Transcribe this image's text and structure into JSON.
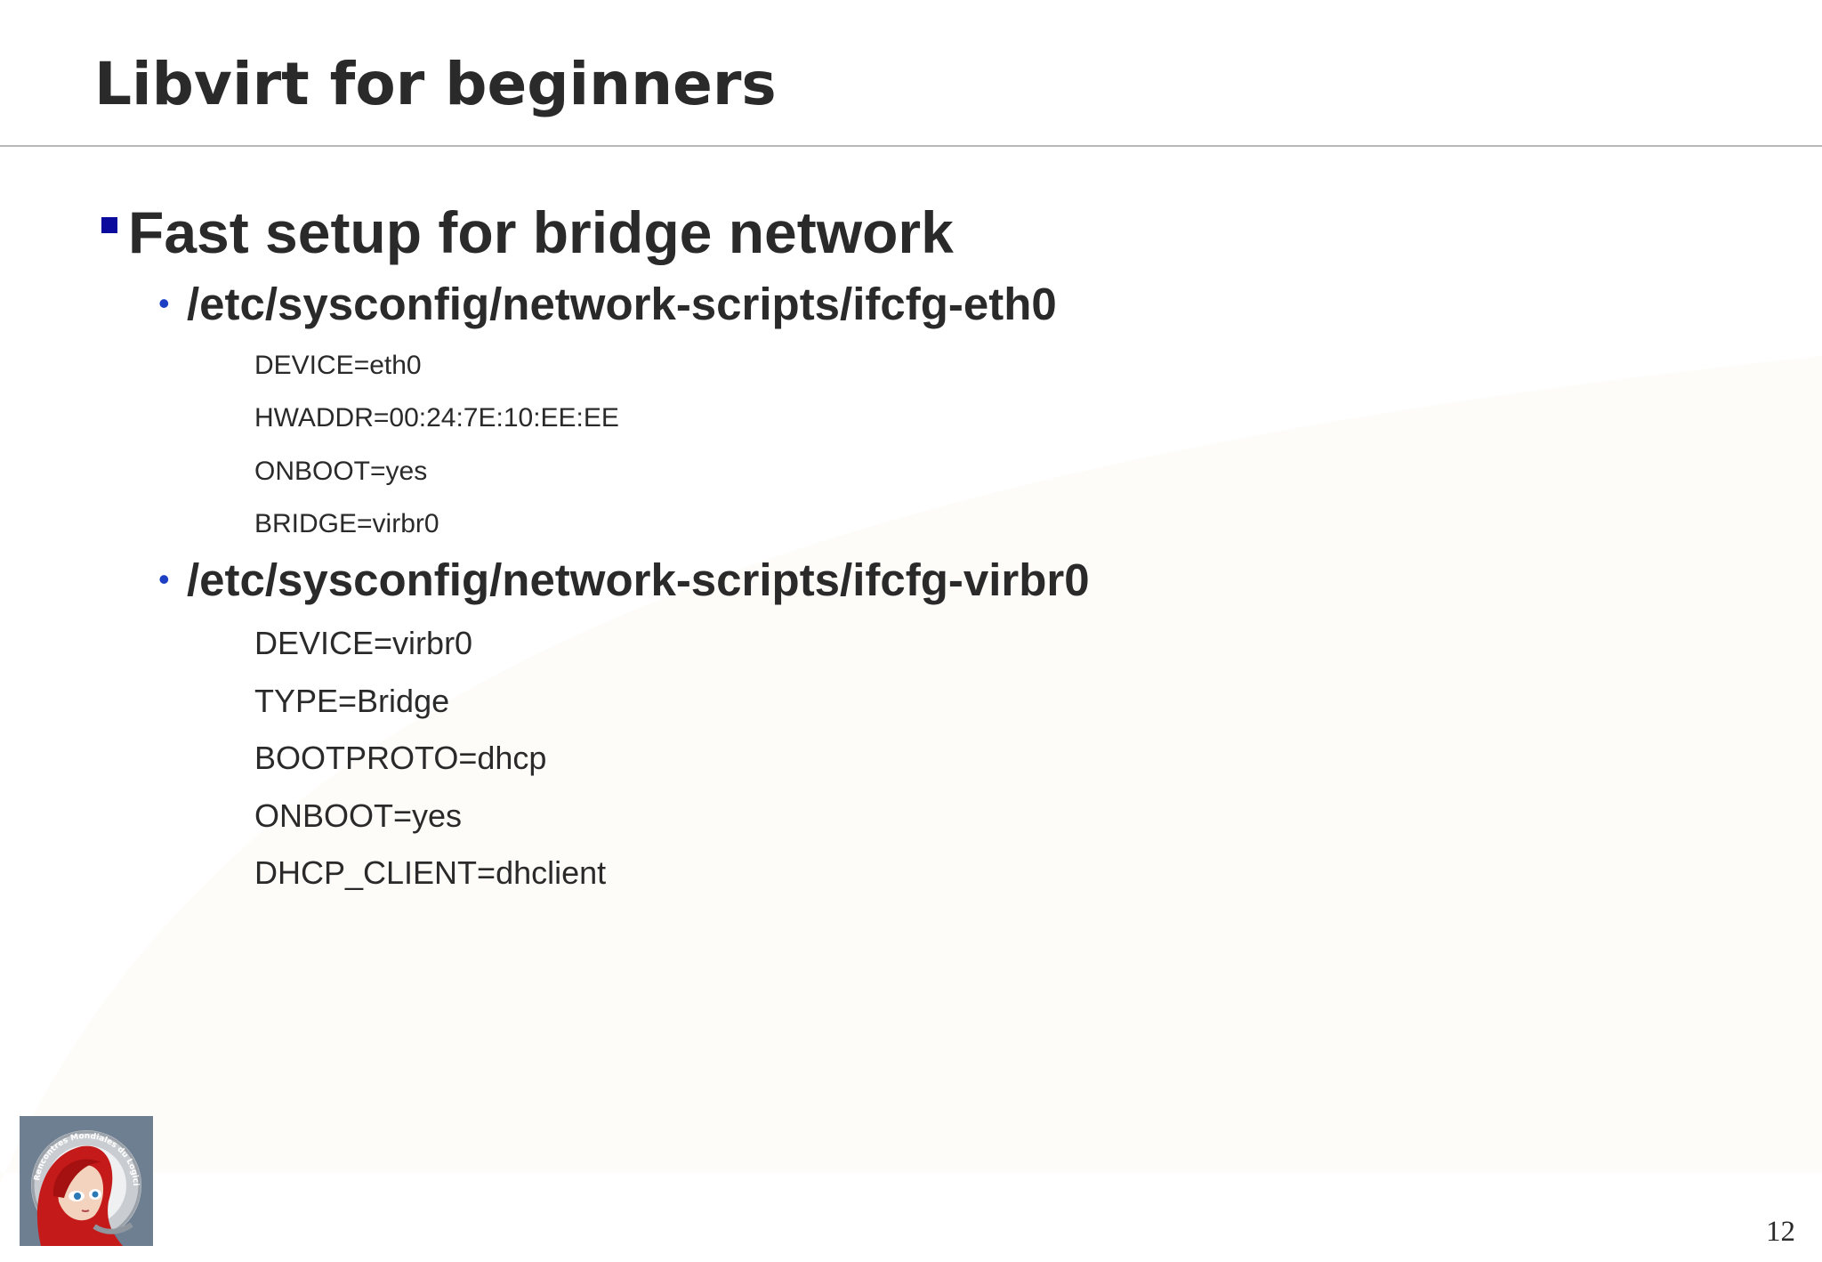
{
  "slide": {
    "title": "Libvirt for beginners",
    "heading": "Fast setup for bridge network",
    "sections": [
      {
        "path": "/etc/sysconfig/network-scripts/ifcfg-eth0",
        "lines": [
          "DEVICE=eth0",
          "HWADDR=00:24:7E:10:EE:EE",
          "ONBOOT=yes",
          "BRIDGE=virbr0"
        ]
      },
      {
        "path": "/etc/sysconfig/network-scripts/ifcfg-virbr0",
        "lines": [
          "DEVICE=virbr0",
          "TYPE=Bridge",
          "BOOTPROTO=dhcp",
          "ONBOOT=yes",
          "DHCP_CLIENT=dhclient"
        ]
      }
    ],
    "page_number": "12",
    "logo_text": "Rencontres Mondiales du Logiciel Libre"
  },
  "colors": {
    "text": "#2a2a2a",
    "bullet_square": "#0a0a9c",
    "bullet_dot": "#1d3fc4",
    "rule": "#b8b8b8"
  },
  "icons": {
    "level1_bullet": "square-bullet-icon",
    "level2_bullet": "dot-bullet-icon",
    "logo": "rmll-mascot-logo"
  }
}
